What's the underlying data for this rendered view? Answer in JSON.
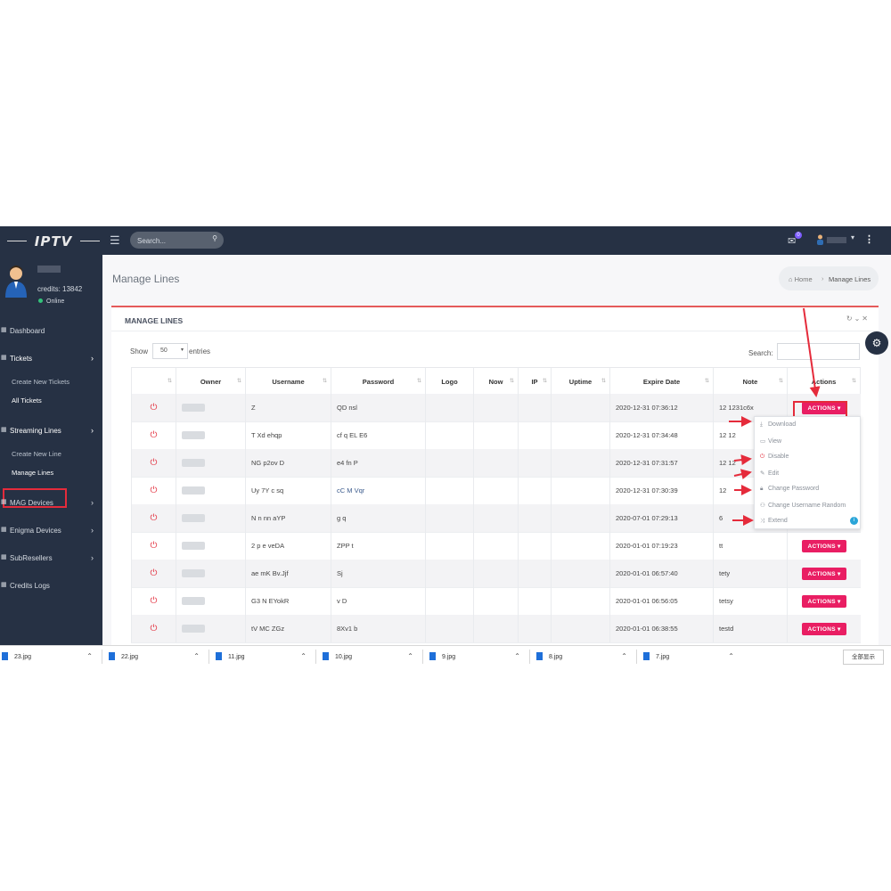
{
  "app": {
    "logo": "IPTV"
  },
  "topbar": {
    "search_placeholder": "Search...",
    "mail_badge": "0"
  },
  "sidebar": {
    "credits": "credits: 13842",
    "status": "Online",
    "items": [
      {
        "label": "Dashboard",
        "icon": "grid-icon"
      },
      {
        "label": "Tickets",
        "icon": "grid-icon",
        "children": [
          "Create New Tickets",
          "All Tickets"
        ]
      },
      {
        "label": "Streaming Lines",
        "icon": "grid-icon",
        "children": [
          "Create New Line",
          "Manage Lines"
        ]
      },
      {
        "label": "MAG Devices",
        "icon": "grid-icon"
      },
      {
        "label": "Enigma Devices",
        "icon": "grid-icon"
      },
      {
        "label": "SubResellers",
        "icon": "grid-icon"
      },
      {
        "label": "Credits Logs",
        "icon": "grid-icon"
      }
    ]
  },
  "page": {
    "title": "Manage Lines",
    "breadcrumb": {
      "home": "Home",
      "separator": "›",
      "current": "Manage Lines"
    }
  },
  "card": {
    "title": "MANAGE LINES",
    "show_label": "Show",
    "entries_value": "50",
    "entries_label": "entries",
    "search_label": "Search:"
  },
  "table": {
    "columns": [
      "",
      "Owner",
      "Username",
      "Password",
      "Logo",
      "Now",
      "IP",
      "Uptime",
      "Expire Date",
      "Note",
      "Actions"
    ],
    "actions_label": "ACTIONS",
    "rows": [
      {
        "username": "Z",
        "password": "QD nsl",
        "expire": "2020-12-31 07:36:12",
        "note": "12 1231c6x",
        "actions": true
      },
      {
        "username": "T Xd ehqp",
        "password": "cf q EL E6",
        "expire": "2020-12-31 07:34:48",
        "note": "12 12",
        "actions": false
      },
      {
        "username": "NG p2ov D",
        "password": "e4 fn P",
        "expire": "2020-12-31 07:31:57",
        "note": "12 12",
        "actions": false
      },
      {
        "username": "Uy 7Y c sq",
        "password": "cC M Vqr",
        "expire": "2020-12-31 07:30:39",
        "note": "12",
        "actions": false
      },
      {
        "username": "N n nn aYP",
        "password": "g q",
        "expire": "2020-07-01 07:29:13",
        "note": "6",
        "actions": false
      },
      {
        "username": "2 p e veDA",
        "password": "ZPP t",
        "expire": "2020-01-01 07:19:23",
        "note": "tt",
        "actions": true
      },
      {
        "username": "ae mK Bv.Jjf",
        "password": "Sj",
        "expire": "2020-01-01 06:57:40",
        "note": "tety",
        "actions": true
      },
      {
        "username": "G3 N EYokR",
        "password": "v D",
        "expire": "2020-01-01 06:56:05",
        "note": "tetsy",
        "actions": true
      },
      {
        "username": "tV MC ZGz",
        "password": "8Xv1 b",
        "expire": "2020-01-01 06:38:55",
        "note": "testd",
        "actions": true
      }
    ]
  },
  "dropdown": {
    "items": [
      {
        "label": "Download",
        "icon": "download-icon"
      },
      {
        "label": "View",
        "icon": "view-icon"
      },
      {
        "label": "Disable",
        "icon": "power-icon"
      },
      {
        "label": "Edit",
        "icon": "pencil-icon"
      },
      {
        "label": "Change Password",
        "icon": "lock-icon"
      },
      {
        "label": "Change Username Random",
        "icon": "users-icon"
      },
      {
        "label": "Extend",
        "icon": "shuffle-icon"
      }
    ]
  },
  "taskbar": {
    "files": [
      "23.jpg",
      "22.jpg",
      "11.jpg",
      "10.jpg",
      "9.jpg",
      "8.jpg",
      "7.jpg"
    ],
    "show_all": "全部显示"
  },
  "colors": {
    "sidebar": "#263144",
    "accent": "#e91e63",
    "annotation": "#e52b3b",
    "online": "#33c27a"
  }
}
